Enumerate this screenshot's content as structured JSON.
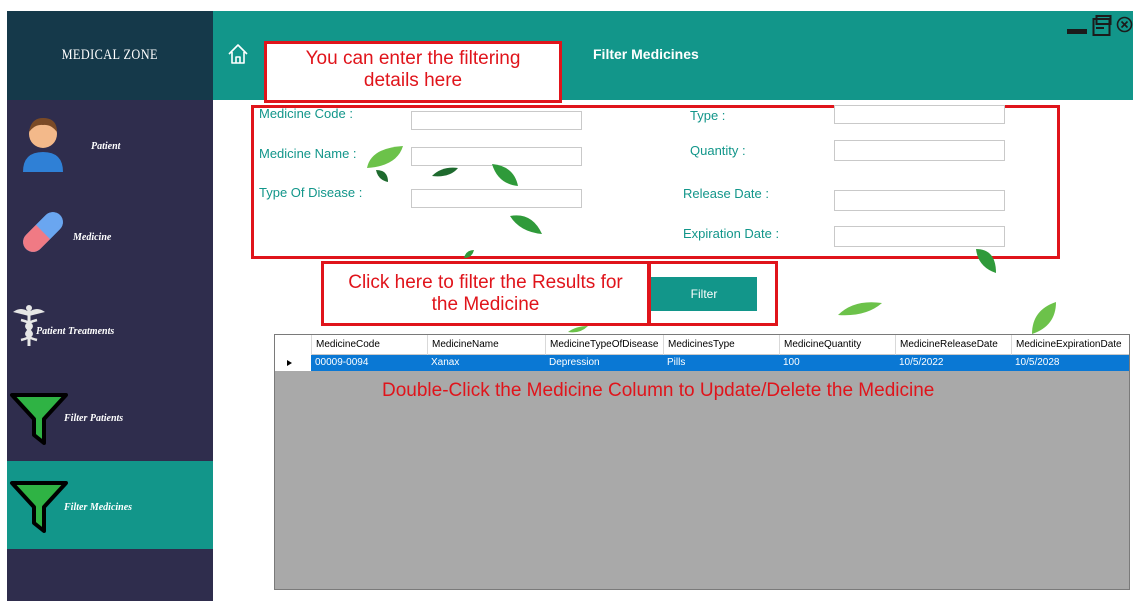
{
  "app": {
    "logo": "MEDICAL ZONE"
  },
  "sidebar": {
    "items": [
      {
        "label": "Patient"
      },
      {
        "label": "Medicine"
      },
      {
        "label": "Patient Treatments"
      },
      {
        "label": "Filter Patients"
      },
      {
        "label": "Filter Medicines"
      }
    ]
  },
  "header": {
    "title": "Filter Medicines"
  },
  "annotations": {
    "enter_details": "You can enter the filtering details here",
    "click_filter": "Click here to filter the Results for the Medicine",
    "double_click": "Double-Click the Medicine Column to Update/Delete the Medicine"
  },
  "form": {
    "medicine_code": {
      "label": "Medicine Code  :",
      "value": ""
    },
    "medicine_name": {
      "label": "Medicine Name :",
      "value": ""
    },
    "type_of_disease": {
      "label": "Type Of Disease :",
      "value": ""
    },
    "type": {
      "label": "Type :",
      "value": ""
    },
    "quantity": {
      "label": "Quantity :",
      "value": ""
    },
    "release_date": {
      "label": "Release Date  :",
      "value": ""
    },
    "expiration_date": {
      "label": "Expiration Date :",
      "value": ""
    },
    "filter_label": "Filter"
  },
  "grid": {
    "columns": [
      "MedicineCode",
      "MedicineName",
      "MedicineTypeOfDisease",
      "MedicinesType",
      "MedicineQuantity",
      "MedicineReleaseDate",
      "MedicineExpirationDate"
    ],
    "rows": [
      [
        "00009-0094",
        "Xanax",
        "Depression",
        "Pills",
        "100",
        "10/5/2022",
        "10/5/2028"
      ]
    ]
  },
  "colors": {
    "teal": "#12968a",
    "sidebar": "#2f2d4d",
    "logo_bg": "#15394a",
    "annotation": "#e0141b",
    "selection": "#0a78d4"
  }
}
